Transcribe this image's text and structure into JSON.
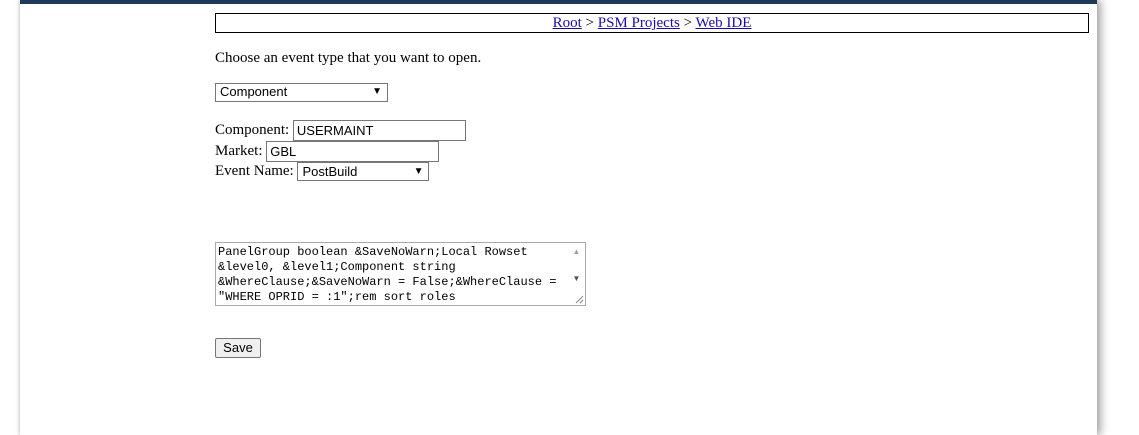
{
  "breadcrumb": {
    "items": [
      "Root",
      "PSM Projects",
      "Web IDE"
    ],
    "separator": ">"
  },
  "instruction": "Choose an event type that you want to open.",
  "event_type_select": {
    "value": "Component"
  },
  "form": {
    "component_label": "Component:",
    "component_value": "USERMAINT",
    "market_label": "Market:",
    "market_value": "GBL",
    "event_name_label": "Event Name:",
    "event_name_value": "PostBuild"
  },
  "code": {
    "lines": [
      "PanelGroup boolean &SaveNoWarn;Local Rowset",
      "&level0, &level1;Component string",
      "&WhereClause;&SaveNoWarn = False;&WhereClause =",
      "\"WHERE OPRID = :1\";rem sort roles"
    ]
  },
  "save_label": "Save",
  "colors": {
    "top_bar": "#1f3a5a",
    "link": "#1a0dab"
  }
}
